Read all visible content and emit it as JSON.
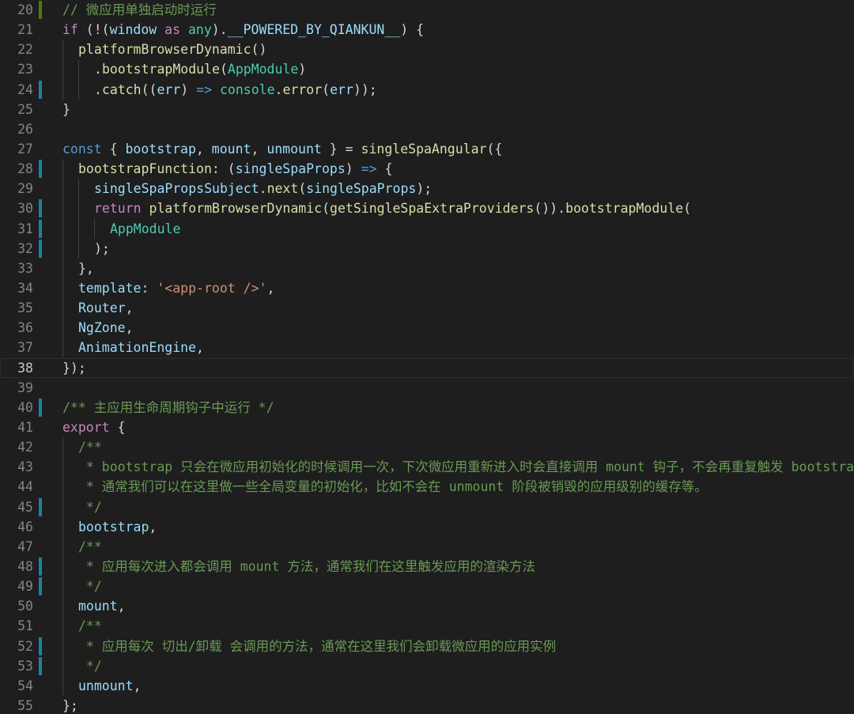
{
  "editor": {
    "language": "typescript",
    "current_line": 38,
    "lines": [
      {
        "n": "20",
        "gutter": "add",
        "indent": 0,
        "tokens": [
          {
            "t": "// 微应用单独启动时运行",
            "c": "cmt"
          }
        ]
      },
      {
        "n": "21",
        "gutter": "",
        "indent": 0,
        "tokens": [
          {
            "t": "if",
            "c": "ctl"
          },
          {
            "t": " (!(",
            "c": "pun"
          },
          {
            "t": "window",
            "c": "var"
          },
          {
            "t": " ",
            "c": "pun"
          },
          {
            "t": "as",
            "c": "ctl"
          },
          {
            "t": " ",
            "c": "pun"
          },
          {
            "t": "any",
            "c": "typ"
          },
          {
            "t": ").",
            "c": "pun"
          },
          {
            "t": "__POWERED_BY_QIANKUN__",
            "c": "var"
          },
          {
            "t": ") {",
            "c": "pun"
          }
        ]
      },
      {
        "n": "22",
        "gutter": "",
        "indent": 1,
        "tokens": [
          {
            "t": "platformBrowserDynamic",
            "c": "fn"
          },
          {
            "t": "()",
            "c": "pun"
          }
        ]
      },
      {
        "n": "23",
        "gutter": "",
        "indent": 2,
        "tokens": [
          {
            "t": ".",
            "c": "pun"
          },
          {
            "t": "bootstrapModule",
            "c": "fn"
          },
          {
            "t": "(",
            "c": "pun"
          },
          {
            "t": "AppModule",
            "c": "typ"
          },
          {
            "t": ")",
            "c": "pun"
          }
        ]
      },
      {
        "n": "24",
        "gutter": "mod",
        "indent": 2,
        "tokens": [
          {
            "t": ".",
            "c": "pun"
          },
          {
            "t": "catch",
            "c": "fn"
          },
          {
            "t": "((",
            "c": "pun"
          },
          {
            "t": "err",
            "c": "var"
          },
          {
            "t": ") ",
            "c": "pun"
          },
          {
            "t": "=>",
            "c": "kw"
          },
          {
            "t": " ",
            "c": "pun"
          },
          {
            "t": "console",
            "c": "typ"
          },
          {
            "t": ".",
            "c": "pun"
          },
          {
            "t": "error",
            "c": "fn"
          },
          {
            "t": "(",
            "c": "pun"
          },
          {
            "t": "err",
            "c": "var"
          },
          {
            "t": "));",
            "c": "pun"
          }
        ]
      },
      {
        "n": "25",
        "gutter": "",
        "indent": 0,
        "tokens": [
          {
            "t": "}",
            "c": "pun"
          }
        ]
      },
      {
        "n": "26",
        "gutter": "",
        "indent": 0,
        "tokens": []
      },
      {
        "n": "27",
        "gutter": "",
        "indent": 0,
        "tokens": [
          {
            "t": "const",
            "c": "kw"
          },
          {
            "t": " { ",
            "c": "pun"
          },
          {
            "t": "bootstrap",
            "c": "var"
          },
          {
            "t": ", ",
            "c": "pun"
          },
          {
            "t": "mount",
            "c": "var"
          },
          {
            "t": ", ",
            "c": "pun"
          },
          {
            "t": "unmount",
            "c": "var"
          },
          {
            "t": " } = ",
            "c": "pun"
          },
          {
            "t": "singleSpaAngular",
            "c": "fn"
          },
          {
            "t": "({",
            "c": "pun"
          }
        ]
      },
      {
        "n": "28",
        "gutter": "mod",
        "indent": 1,
        "tokens": [
          {
            "t": "bootstrapFunction",
            "c": "fn"
          },
          {
            "t": ": (",
            "c": "pun"
          },
          {
            "t": "singleSpaProps",
            "c": "var"
          },
          {
            "t": ") ",
            "c": "pun"
          },
          {
            "t": "=>",
            "c": "kw"
          },
          {
            "t": " {",
            "c": "pun"
          }
        ]
      },
      {
        "n": "29",
        "gutter": "",
        "indent": 2,
        "tokens": [
          {
            "t": "singleSpaPropsSubject",
            "c": "var"
          },
          {
            "t": ".",
            "c": "pun"
          },
          {
            "t": "next",
            "c": "fn"
          },
          {
            "t": "(",
            "c": "pun"
          },
          {
            "t": "singleSpaProps",
            "c": "var"
          },
          {
            "t": ");",
            "c": "pun"
          }
        ]
      },
      {
        "n": "30",
        "gutter": "mod",
        "indent": 2,
        "tokens": [
          {
            "t": "return",
            "c": "ctl"
          },
          {
            "t": " ",
            "c": "pun"
          },
          {
            "t": "platformBrowserDynamic",
            "c": "fn"
          },
          {
            "t": "(",
            "c": "pun"
          },
          {
            "t": "getSingleSpaExtraProviders",
            "c": "fn"
          },
          {
            "t": "()).",
            "c": "pun"
          },
          {
            "t": "bootstrapModule",
            "c": "fn"
          },
          {
            "t": "(",
            "c": "pun"
          }
        ]
      },
      {
        "n": "31",
        "gutter": "mod",
        "indent": 3,
        "tokens": [
          {
            "t": "AppModule",
            "c": "typ"
          }
        ]
      },
      {
        "n": "32",
        "gutter": "mod",
        "indent": 2,
        "tokens": [
          {
            "t": ");",
            "c": "pun"
          }
        ]
      },
      {
        "n": "33",
        "gutter": "",
        "indent": 1,
        "tokens": [
          {
            "t": "},",
            "c": "pun"
          }
        ]
      },
      {
        "n": "34",
        "gutter": "",
        "indent": 1,
        "tokens": [
          {
            "t": "template",
            "c": "var"
          },
          {
            "t": ": ",
            "c": "pun"
          },
          {
            "t": "'<app-root />'",
            "c": "str"
          },
          {
            "t": ",",
            "c": "pun"
          }
        ]
      },
      {
        "n": "35",
        "gutter": "",
        "indent": 1,
        "tokens": [
          {
            "t": "Router",
            "c": "var"
          },
          {
            "t": ",",
            "c": "pun"
          }
        ]
      },
      {
        "n": "36",
        "gutter": "",
        "indent": 1,
        "tokens": [
          {
            "t": "NgZone",
            "c": "var"
          },
          {
            "t": ",",
            "c": "pun"
          }
        ]
      },
      {
        "n": "37",
        "gutter": "",
        "indent": 1,
        "tokens": [
          {
            "t": "AnimationEngine",
            "c": "var"
          },
          {
            "t": ",",
            "c": "pun"
          }
        ]
      },
      {
        "n": "38",
        "gutter": "",
        "indent": 0,
        "tokens": [
          {
            "t": "});",
            "c": "pun"
          }
        ]
      },
      {
        "n": "39",
        "gutter": "",
        "indent": 0,
        "tokens": []
      },
      {
        "n": "40",
        "gutter": "mod",
        "indent": 0,
        "tokens": [
          {
            "t": "/** 主应用生命周期钩子中运行 */",
            "c": "cmt"
          }
        ]
      },
      {
        "n": "41",
        "gutter": "",
        "indent": 0,
        "tokens": [
          {
            "t": "export",
            "c": "ctl"
          },
          {
            "t": " {",
            "c": "pun"
          }
        ]
      },
      {
        "n": "42",
        "gutter": "",
        "indent": 1,
        "tokens": [
          {
            "t": "/**",
            "c": "cmt"
          }
        ]
      },
      {
        "n": "43",
        "gutter": "",
        "indent": 1,
        "tokens": [
          {
            "t": " * bootstrap 只会在微应用初始化的时候调用一次，下次微应用重新进入时会直接调用 mount 钩子，不会再重复触发 bootstrap",
            "c": "cmt"
          }
        ]
      },
      {
        "n": "44",
        "gutter": "",
        "indent": 1,
        "tokens": [
          {
            "t": " * 通常我们可以在这里做一些全局变量的初始化，比如不会在 unmount 阶段被销毁的应用级别的缓存等。",
            "c": "cmt"
          }
        ]
      },
      {
        "n": "45",
        "gutter": "mod",
        "indent": 1,
        "tokens": [
          {
            "t": " */",
            "c": "cmt"
          }
        ]
      },
      {
        "n": "46",
        "gutter": "",
        "indent": 1,
        "tokens": [
          {
            "t": "bootstrap",
            "c": "var"
          },
          {
            "t": ",",
            "c": "pun"
          }
        ]
      },
      {
        "n": "47",
        "gutter": "",
        "indent": 1,
        "tokens": [
          {
            "t": "/**",
            "c": "cmt"
          }
        ]
      },
      {
        "n": "48",
        "gutter": "mod",
        "indent": 1,
        "tokens": [
          {
            "t": " * 应用每次进入都会调用 mount 方法，通常我们在这里触发应用的渲染方法",
            "c": "cmt"
          }
        ]
      },
      {
        "n": "49",
        "gutter": "mod",
        "indent": 1,
        "tokens": [
          {
            "t": " */",
            "c": "cmt"
          }
        ]
      },
      {
        "n": "50",
        "gutter": "",
        "indent": 1,
        "tokens": [
          {
            "t": "mount",
            "c": "var"
          },
          {
            "t": ",",
            "c": "pun"
          }
        ]
      },
      {
        "n": "51",
        "gutter": "",
        "indent": 1,
        "tokens": [
          {
            "t": "/**",
            "c": "cmt"
          }
        ]
      },
      {
        "n": "52",
        "gutter": "mod",
        "indent": 1,
        "tokens": [
          {
            "t": " * 应用每次 切出/卸载 会调用的方法，通常在这里我们会卸载微应用的应用实例",
            "c": "cmt"
          }
        ]
      },
      {
        "n": "53",
        "gutter": "mod",
        "indent": 1,
        "tokens": [
          {
            "t": " */",
            "c": "cmt"
          }
        ]
      },
      {
        "n": "54",
        "gutter": "",
        "indent": 1,
        "tokens": [
          {
            "t": "unmount",
            "c": "var"
          },
          {
            "t": ",",
            "c": "pun"
          }
        ]
      },
      {
        "n": "55",
        "gutter": "",
        "indent": 0,
        "tokens": [
          {
            "t": "};",
            "c": "pun"
          }
        ]
      }
    ]
  }
}
